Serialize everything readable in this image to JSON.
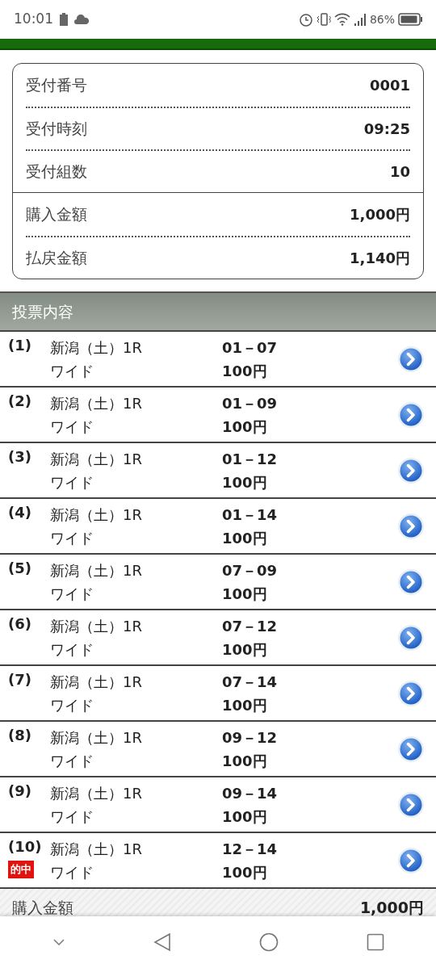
{
  "status_bar": {
    "time": "10:01",
    "battery": "86%"
  },
  "summary": {
    "groups": [
      {
        "items": [
          {
            "label": "受付番号",
            "value": "0001"
          },
          {
            "label": "受付時刻",
            "value": "09:25"
          },
          {
            "label": "受付組数",
            "value": "10"
          }
        ]
      },
      {
        "items": [
          {
            "label": "購入金額",
            "value": "1,000円"
          },
          {
            "label": "払戻金額",
            "value": "1,140円"
          }
        ]
      }
    ]
  },
  "section_title": "投票内容",
  "hit_label": "的中",
  "bets": [
    {
      "number": "(1)",
      "race": "新潟（土）1R",
      "bet_type": "ワイド",
      "combination": "01－07",
      "amount": "100円",
      "hit": false
    },
    {
      "number": "(2)",
      "race": "新潟（土）1R",
      "bet_type": "ワイド",
      "combination": "01－09",
      "amount": "100円",
      "hit": false
    },
    {
      "number": "(3)",
      "race": "新潟（土）1R",
      "bet_type": "ワイド",
      "combination": "01－12",
      "amount": "100円",
      "hit": false
    },
    {
      "number": "(4)",
      "race": "新潟（土）1R",
      "bet_type": "ワイド",
      "combination": "01－14",
      "amount": "100円",
      "hit": false
    },
    {
      "number": "(5)",
      "race": "新潟（土）1R",
      "bet_type": "ワイド",
      "combination": "07－09",
      "amount": "100円",
      "hit": false
    },
    {
      "number": "(6)",
      "race": "新潟（土）1R",
      "bet_type": "ワイド",
      "combination": "07－12",
      "amount": "100円",
      "hit": false
    },
    {
      "number": "(7)",
      "race": "新潟（土）1R",
      "bet_type": "ワイド",
      "combination": "07－14",
      "amount": "100円",
      "hit": false
    },
    {
      "number": "(8)",
      "race": "新潟（土）1R",
      "bet_type": "ワイド",
      "combination": "09－12",
      "amount": "100円",
      "hit": false
    },
    {
      "number": "(9)",
      "race": "新潟（土）1R",
      "bet_type": "ワイド",
      "combination": "09－14",
      "amount": "100円",
      "hit": false
    },
    {
      "number": "(10)",
      "race": "新潟（土）1R",
      "bet_type": "ワイド",
      "combination": "12－14",
      "amount": "100円",
      "hit": true
    }
  ],
  "footer": {
    "label": "購入金額",
    "value": "1,000円"
  }
}
